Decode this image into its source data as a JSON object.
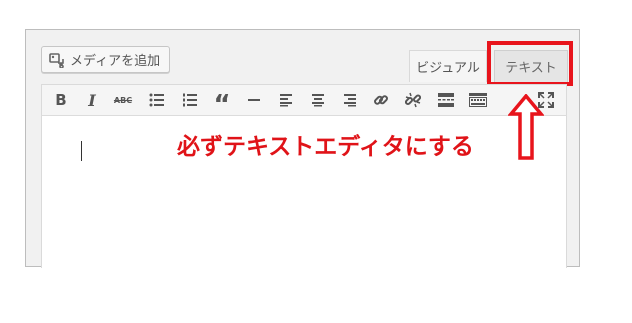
{
  "media_button": {
    "label": "メディアを追加",
    "icon": "media-icon"
  },
  "tabs": [
    {
      "label": "ビジュアル",
      "active": false
    },
    {
      "label": "テキスト",
      "active": true
    }
  ],
  "toolbar": {
    "bold": "B",
    "italic": "I",
    "strikethrough": "ABC",
    "blockquote": "“",
    "buttons": [
      "bold",
      "italic",
      "strikethrough",
      "bullet-list",
      "numbered-list",
      "blockquote",
      "horizontal-rule",
      "align-left",
      "align-center",
      "align-right",
      "link",
      "unlink",
      "read-more",
      "toolbar-toggle",
      "fullscreen"
    ]
  },
  "annotation": {
    "text": "必ずテキストエディタにする",
    "highlight_color": "#e8141c",
    "text_color": "#e01318"
  }
}
